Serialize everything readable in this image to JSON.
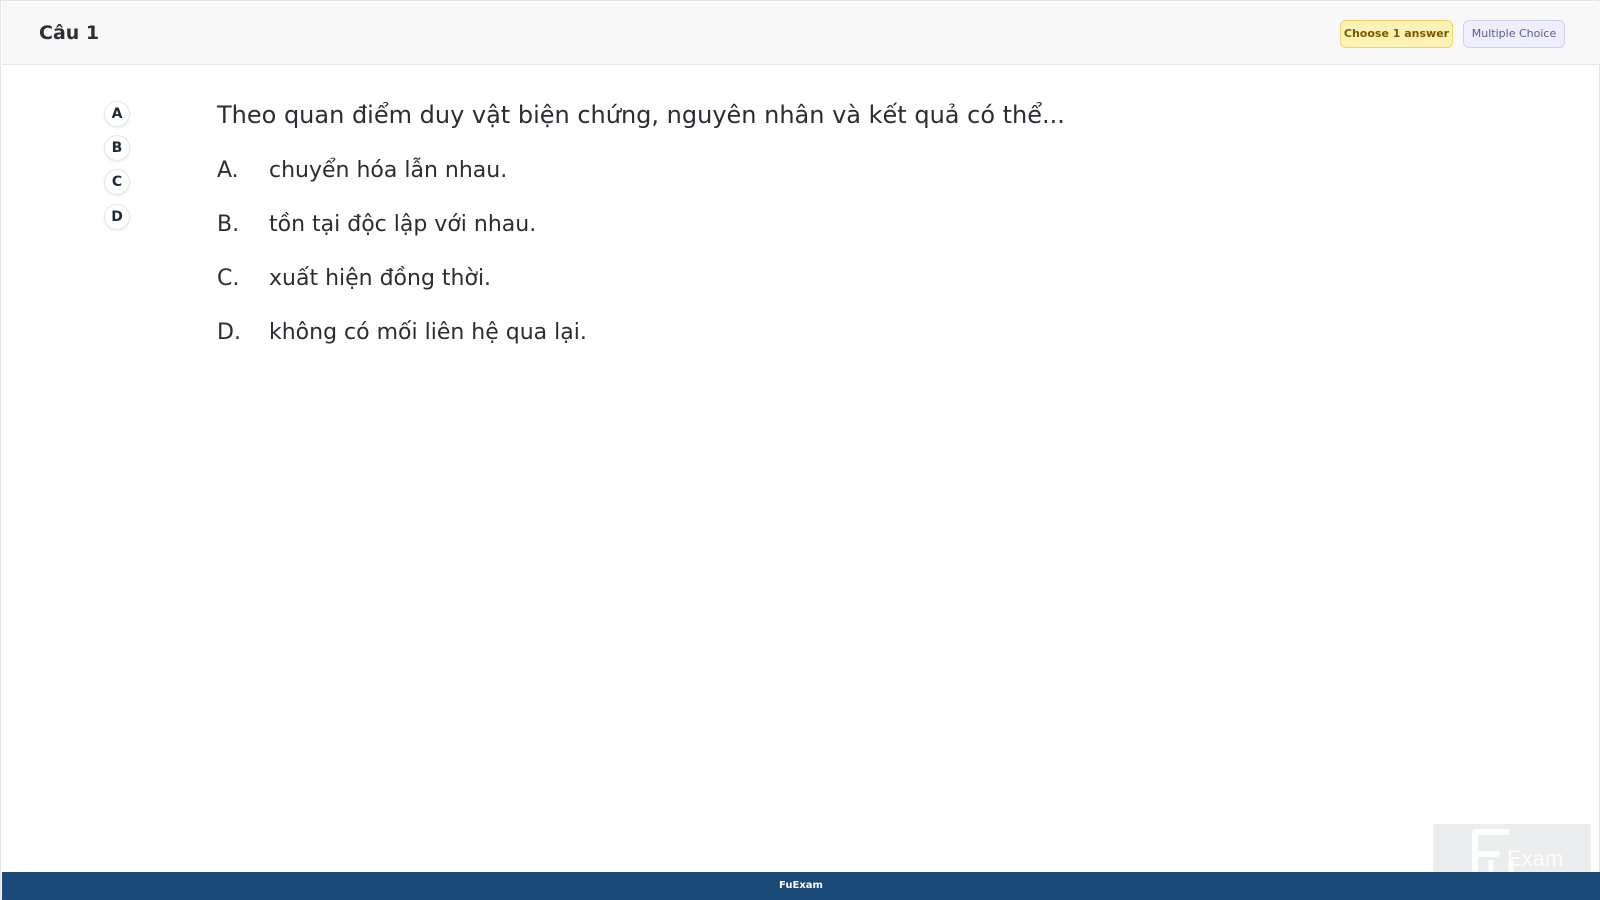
{
  "header": {
    "title": "Câu 1",
    "badges": {
      "choose": "Choose 1 answer",
      "type": "Multiple Choice"
    }
  },
  "answer_buttons": [
    "A",
    "B",
    "C",
    "D"
  ],
  "question": {
    "text": "Theo quan điểm duy vật biện chứng, nguyên nhân và kết quả có thể...",
    "options": [
      {
        "letter": "A.",
        "text": "chuyển hóa lẫn nhau."
      },
      {
        "letter": "B.",
        "text": "tồn tại độc lập với nhau."
      },
      {
        "letter": "C.",
        "text": "xuất hiện đồng thời."
      },
      {
        "letter": "D.",
        "text": "không có mối liên hệ qua lại."
      }
    ]
  },
  "footer": {
    "label": "FuExam"
  },
  "watermark": {
    "logo_text": "FUExam"
  },
  "colors": {
    "footer_bg": "#1b4a78",
    "choose_badge_bg": "#fdf2b5",
    "type_badge_bg": "#eeeeff"
  }
}
